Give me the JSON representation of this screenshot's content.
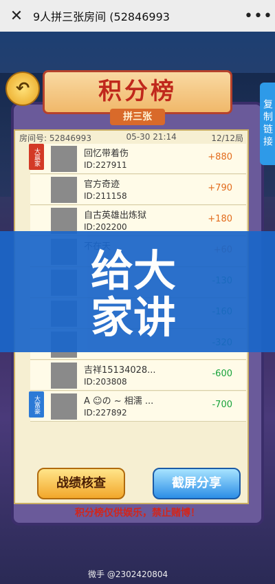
{
  "topbar": {
    "title": "9人拼三张房间 (52846993",
    "close_icon": "close-icon",
    "more_icon": "more-icon"
  },
  "board": {
    "title": "积分榜",
    "subtitle": "拼三张",
    "copy_link": "复制链接",
    "info": {
      "room_label": "房间号:",
      "room_number": "52846993",
      "datetime": "05-30 21:14",
      "rounds": "12/12局"
    }
  },
  "rows": [
    {
      "name": "回忆带着伤",
      "id": "ID:227911",
      "score": "+880",
      "badge": "大赢家",
      "badge_color": "#d33a26"
    },
    {
      "name": "官方奇迹",
      "id": "ID:211158",
      "score": "+790"
    },
    {
      "name": "自古英雄出炼狱",
      "id": "ID:202200",
      "score": "+180"
    },
    {
      "name": "不在天",
      "id": "",
      "score": "+60"
    },
    {
      "name": "",
      "id": "",
      "score": "-130"
    },
    {
      "name": "",
      "id": "",
      "score": "-160"
    },
    {
      "name": "",
      "id": "",
      "score": "-320"
    },
    {
      "name": "吉祥15134028...",
      "id": "ID:203808",
      "score": "-600"
    },
    {
      "name": "A ☺の ~ 相濡 ...",
      "id": "ID:227892",
      "score": "-700",
      "badge": "大富豪",
      "badge_color": "#2c7ad6"
    }
  ],
  "overlay": {
    "text": "给大家讲"
  },
  "buttons": {
    "stats": "战绩核查",
    "share": "截屏分享"
  },
  "warning": "积分榜仅供娱乐，禁止赌博！",
  "watermark": "微手 @2302420804"
}
